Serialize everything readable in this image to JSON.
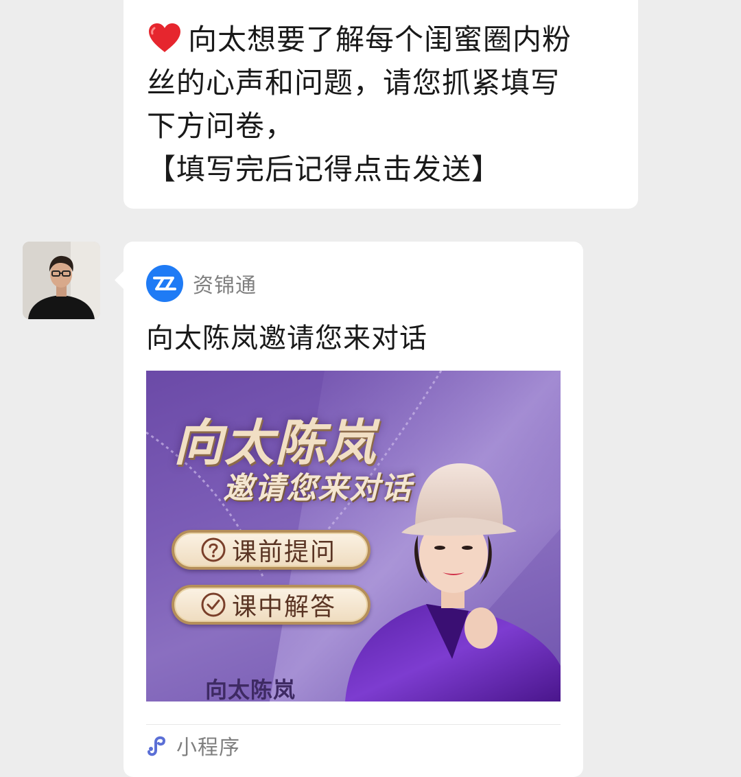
{
  "message": {
    "lines": [
      "向太想要了解每个闺蜜圈内粉",
      "丝的心声和问题，请您抓紧填写",
      "下方问卷，",
      "【填写完后记得点击发送】"
    ],
    "leading_icon": "red-heart-icon"
  },
  "sender": {
    "avatar_icon": "person-avatar"
  },
  "card": {
    "app_name": "资锦通",
    "app_icon": "zz-logo-icon",
    "title": "向太陈岚邀请您来对话",
    "banner": {
      "title": "向太陈岚",
      "subtitle": "邀请您来对话",
      "buttons": [
        {
          "label": "课前提问",
          "icon": "question-circle-icon"
        },
        {
          "label": "课中解答",
          "icon": "check-circle-icon"
        }
      ],
      "footer_name": "向太陈岚"
    },
    "footer_label": "小程序",
    "footer_icon": "mini-program-icon"
  },
  "colors": {
    "background": "#ededed",
    "bubble": "#ffffff",
    "brand_blue": "#1f7bf5",
    "banner_purple": "#7b5cb6",
    "heart_red": "#e6262e"
  }
}
